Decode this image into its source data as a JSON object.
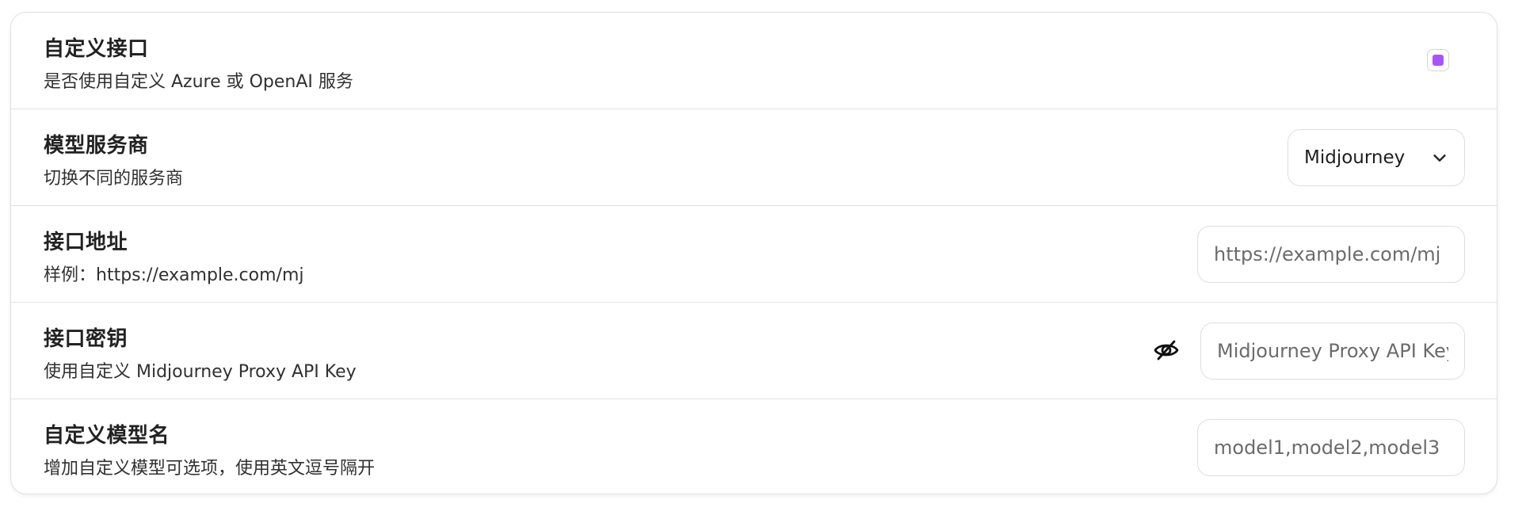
{
  "rows": [
    {
      "title": "自定义接口",
      "subtitle": "是否使用自定义 Azure 或 OpenAI 服务"
    },
    {
      "title": "模型服务商",
      "subtitle": "切换不同的服务商"
    },
    {
      "title": "接口地址",
      "subtitle": "样例：https://example.com/mj"
    },
    {
      "title": "接口密钥",
      "subtitle": "使用自定义 Midjourney Proxy API Key"
    },
    {
      "title": "自定义模型名",
      "subtitle": "增加自定义模型可选项，使用英文逗号隔开"
    }
  ],
  "custom_api": {
    "checked": true,
    "accent_color": "#a855f7"
  },
  "provider": {
    "selected": "Midjourney"
  },
  "endpoint": {
    "value": "",
    "placeholder": "https://example.com/mj"
  },
  "api_key": {
    "value": "",
    "placeholder": "Midjourney Proxy API Key",
    "visibility_icon": "eye-off-icon"
  },
  "custom_models": {
    "value": "",
    "placeholder": "model1,model2,model3"
  }
}
